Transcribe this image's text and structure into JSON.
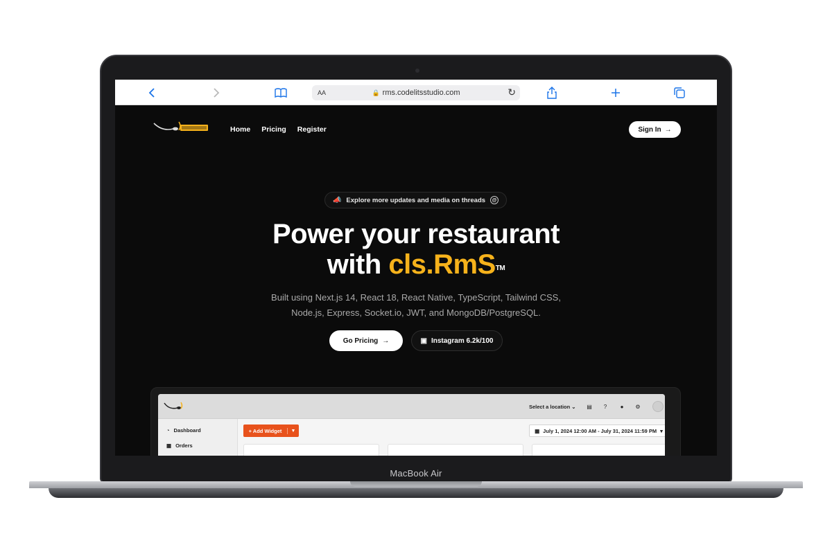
{
  "device": {
    "model_label": "MacBook Air"
  },
  "browser": {
    "text_size_label": "AA",
    "url": "rms.codelitsstudio.com",
    "icons": [
      "chevron-left-icon",
      "chevron-right-icon",
      "book-icon",
      "lock-icon",
      "reload-icon",
      "share-icon",
      "plus-icon",
      "tabs-icon"
    ]
  },
  "site": {
    "nav": {
      "links": [
        "Home",
        "Pricing",
        "Register"
      ],
      "signin_label": "Sign In"
    },
    "announcement": {
      "text": "Explore more updates and media on threads"
    },
    "hero": {
      "title_line1": "Power your restaurant",
      "title_with": "with ",
      "title_brand": "cls.RmS",
      "title_tm": "TM",
      "subtitle": "Built using Next.js 14, React 18, React Native, TypeScript, Tailwind CSS, Node.js, Express, Socket.io, JWT, and MongoDB/PostgreSQL."
    },
    "buttons": {
      "go_pricing": "Go Pricing",
      "instagram": "Instagram 6.2k/100"
    },
    "dashboard_preview": {
      "location_select": "Select a location",
      "sidebar": [
        "Dashboard",
        "Orders"
      ],
      "add_widget": "+ Add Widget",
      "date_range": "July 1, 2024 12:00 AM - July 31, 2024 11:59 PM"
    },
    "colors": {
      "brand_yellow": "#f6b21b",
      "accent_orange": "#e8521c",
      "background": "#0b0b0b"
    }
  }
}
